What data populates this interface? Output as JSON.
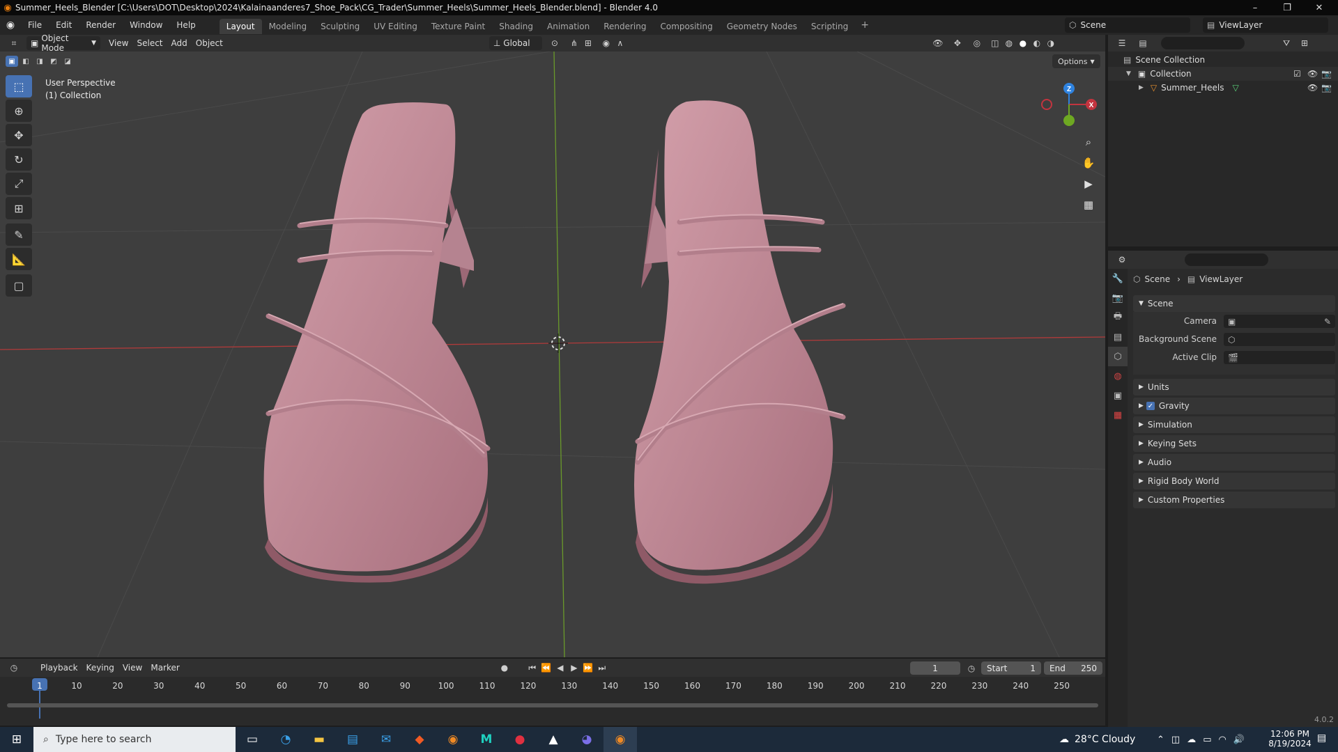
{
  "window": {
    "title": "Summer_Heels_Blender [C:\\Users\\DOT\\Desktop\\2024\\Kalainaanderes7_Shoe_Pack\\CG_Trader\\Summer_Heels\\Summer_Heels_Blender.blend] - Blender 4.0",
    "minimize": "–",
    "restore": "❐",
    "close": "✕"
  },
  "menu": {
    "items": [
      "File",
      "Edit",
      "Render",
      "Window",
      "Help"
    ],
    "workspaces": [
      "Layout",
      "Modeling",
      "Sculpting",
      "UV Editing",
      "Texture Paint",
      "Shading",
      "Animation",
      "Rendering",
      "Compositing",
      "Geometry Nodes",
      "Scripting"
    ],
    "add_tab": "+",
    "scene": "Scene",
    "view_layer": "ViewLayer"
  },
  "viewport": {
    "mode": "Object Mode",
    "menus": [
      "View",
      "Select",
      "Add",
      "Object"
    ],
    "transform_orientation": "Global",
    "options": "Options",
    "info_line1": "User Perspective",
    "info_line2": "(1) Collection",
    "gizmo": {
      "z": "Z",
      "x": "X"
    }
  },
  "outliner": {
    "rows": [
      {
        "label": "Scene Collection"
      },
      {
        "label": "Collection"
      },
      {
        "label": "Summer_Heels"
      }
    ]
  },
  "properties": {
    "breadcrumb": [
      "Scene",
      "ViewLayer"
    ],
    "section": "Scene",
    "fields": [
      {
        "label": "Camera"
      },
      {
        "label": "Background Scene"
      },
      {
        "label": "Active Clip"
      }
    ],
    "panels": [
      "Units",
      "Gravity",
      "Simulation",
      "Keying Sets",
      "Audio",
      "Rigid Body World",
      "Custom Properties"
    ],
    "gravity_checked": true
  },
  "timeline": {
    "menus": [
      "Playback",
      "Keying",
      "View",
      "Marker"
    ],
    "current_frame": "1",
    "start_label": "Start",
    "start": "1",
    "end_label": "End",
    "end": "250",
    "ruler": [
      "1",
      "10",
      "20",
      "30",
      "40",
      "50",
      "60",
      "70",
      "80",
      "90",
      "100",
      "110",
      "120",
      "130",
      "140",
      "150",
      "160",
      "170",
      "180",
      "190",
      "200",
      "210",
      "220",
      "230",
      "240",
      "250"
    ],
    "version": "4.0.2"
  },
  "taskbar": {
    "search_placeholder": "Type here to search",
    "weather": "28°C  Cloudy",
    "time": "12:06 PM",
    "date": "8/19/2024"
  },
  "colors": {
    "shoe": "#c08a96",
    "accent": "#4772b3",
    "x_axis": "#c3343f",
    "y_axis": "#6ea822",
    "z_axis": "#2f83e0"
  }
}
